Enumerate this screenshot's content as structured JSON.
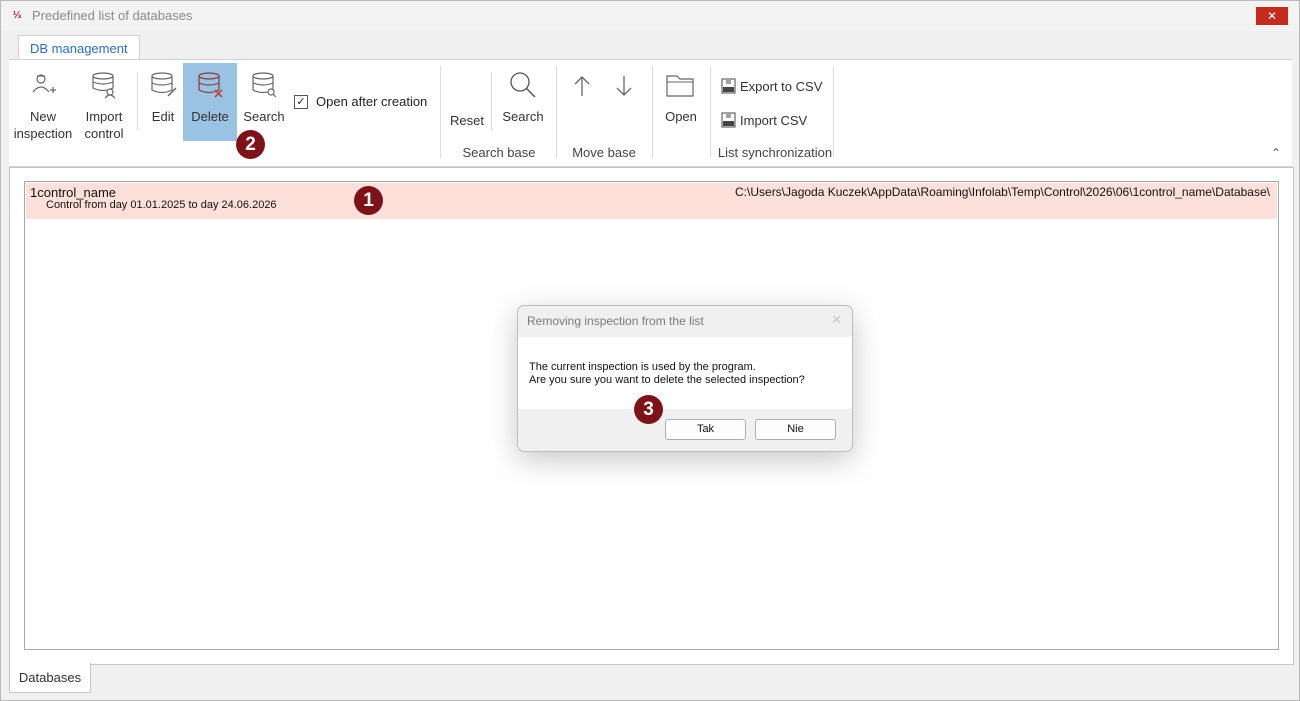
{
  "window": {
    "title": "Predefined list of databases",
    "close_glyph": "✕",
    "app_icon": "infolab-logo-icon"
  },
  "ribbon": {
    "tab": "DB management",
    "buttons": {
      "new_inspection": [
        "New",
        "inspection"
      ],
      "import_control": [
        "Import",
        "control"
      ],
      "edit": "Edit",
      "delete": "Delete",
      "search": "Search",
      "reset": "Reset",
      "search_base": "Search",
      "open": "Open",
      "export_csv": "Export to CSV",
      "import_csv": "Import CSV"
    },
    "checkbox": {
      "label": "Open after creation",
      "checked": true
    },
    "groups": {
      "search_base": "Search base",
      "move_base": "Move base",
      "list_sync": "List synchronization"
    }
  },
  "list": {
    "rows": [
      {
        "name": "1control_name",
        "description": "Control from day 01.01.2025 to day 24.06.2026",
        "path": "C:\\Users\\Jagoda Kuczek\\AppData\\Roaming\\Infolab\\Temp\\Control\\2026\\06\\1control_name\\Database\\"
      }
    ]
  },
  "markers": [
    "1",
    "2",
    "3"
  ],
  "bottom_tabs": [
    "Databases"
  ],
  "dialog": {
    "title": "Removing inspection from the list",
    "line1": "The current inspection is used by the program.",
    "line2": "Are you sure you want to delete the selected inspection?",
    "yes": "Tak",
    "no": "Nie"
  },
  "colors": {
    "accent": "#2a6ebb",
    "selected_button": "#99c2e3",
    "selected_row": "#fde0d9",
    "marker": "#7d1318",
    "close": "#c42b1c"
  }
}
